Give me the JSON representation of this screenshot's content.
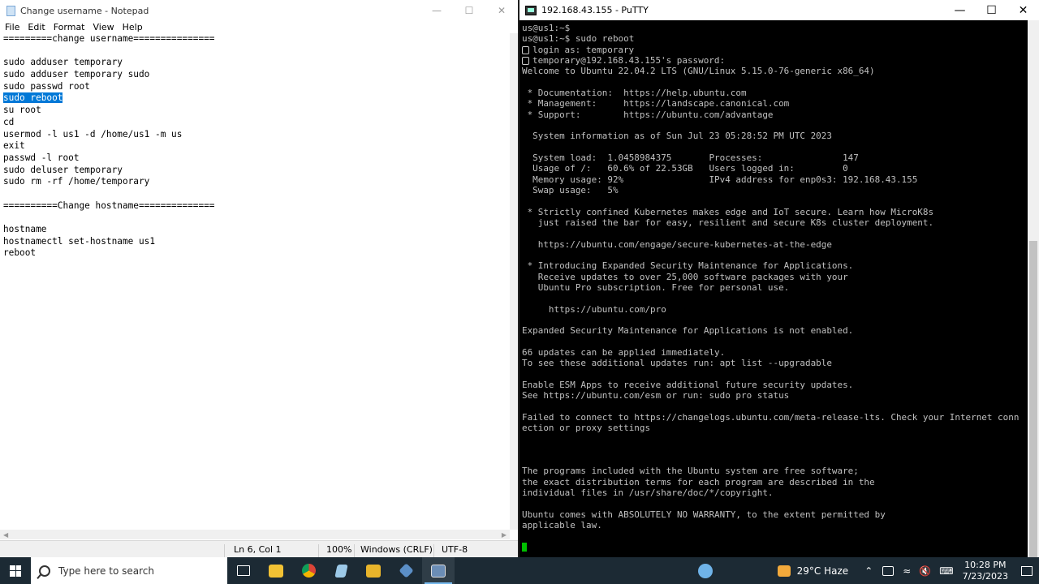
{
  "notepad": {
    "title": "Change username - Notepad",
    "menu": [
      "File",
      "Edit",
      "Format",
      "View",
      "Help"
    ],
    "lines": [
      "=========change username===============",
      "",
      "sudo adduser temporary",
      "sudo adduser temporary sudo",
      "sudo passwd root",
      "sudo reboot",
      "su root",
      "cd",
      "usermod -l us1 -d /home/us1 -m us",
      "exit",
      "passwd -l root",
      "sudo deluser temporary",
      "sudo rm -rf /home/temporary",
      "",
      "==========Change hostname==============",
      "",
      "hostname",
      "hostnamectl set-hostname us1",
      "reboot"
    ],
    "selected_line": 5,
    "status": {
      "position": "Ln 6, Col 1",
      "zoom": "100%",
      "line_ending": "Windows (CRLF)",
      "encoding": "UTF-8"
    }
  },
  "putty": {
    "title": "192.168.43.155 - PuTTY",
    "lines": [
      {
        "t": "us@us1:~$"
      },
      {
        "t": "us@us1:~$ sudo reboot"
      },
      {
        "t": "login as: temporary",
        "key": true
      },
      {
        "t": "temporary@192.168.43.155's password:",
        "key": true
      },
      {
        "t": "Welcome to Ubuntu 22.04.2 LTS (GNU/Linux 5.15.0-76-generic x86_64)"
      },
      {
        "t": ""
      },
      {
        "t": " * Documentation:  https://help.ubuntu.com"
      },
      {
        "t": " * Management:     https://landscape.canonical.com"
      },
      {
        "t": " * Support:        https://ubuntu.com/advantage"
      },
      {
        "t": ""
      },
      {
        "t": "  System information as of Sun Jul 23 05:28:52 PM UTC 2023"
      },
      {
        "t": ""
      },
      {
        "t": "  System load:  1.0458984375       Processes:               147"
      },
      {
        "t": "  Usage of /:   60.6% of 22.53GB   Users logged in:         0"
      },
      {
        "t": "  Memory usage: 92%                IPv4 address for enp0s3: 192.168.43.155"
      },
      {
        "t": "  Swap usage:   5%"
      },
      {
        "t": ""
      },
      {
        "t": " * Strictly confined Kubernetes makes edge and IoT secure. Learn how MicroK8s"
      },
      {
        "t": "   just raised the bar for easy, resilient and secure K8s cluster deployment."
      },
      {
        "t": ""
      },
      {
        "t": "   https://ubuntu.com/engage/secure-kubernetes-at-the-edge"
      },
      {
        "t": ""
      },
      {
        "t": " * Introducing Expanded Security Maintenance for Applications."
      },
      {
        "t": "   Receive updates to over 25,000 software packages with your"
      },
      {
        "t": "   Ubuntu Pro subscription. Free for personal use."
      },
      {
        "t": ""
      },
      {
        "t": "     https://ubuntu.com/pro"
      },
      {
        "t": ""
      },
      {
        "t": "Expanded Security Maintenance for Applications is not enabled."
      },
      {
        "t": ""
      },
      {
        "t": "66 updates can be applied immediately."
      },
      {
        "t": "To see these additional updates run: apt list --upgradable"
      },
      {
        "t": ""
      },
      {
        "t": "Enable ESM Apps to receive additional future security updates."
      },
      {
        "t": "See https://ubuntu.com/esm or run: sudo pro status"
      },
      {
        "t": ""
      },
      {
        "t": "Failed to connect to https://changelogs.ubuntu.com/meta-release-lts. Check your Internet conn"
      },
      {
        "t": "ection or proxy settings"
      },
      {
        "t": ""
      },
      {
        "t": ""
      },
      {
        "t": ""
      },
      {
        "t": "The programs included with the Ubuntu system are free software;"
      },
      {
        "t": "the exact distribution terms for each program are described in the"
      },
      {
        "t": "individual files in /usr/share/doc/*/copyright."
      },
      {
        "t": ""
      },
      {
        "t": "Ubuntu comes with ABSOLUTELY NO WARRANTY, to the extent permitted by"
      },
      {
        "t": "applicable law."
      },
      {
        "t": ""
      },
      {
        "t": "",
        "cursor": true
      }
    ]
  },
  "taskbar": {
    "search_placeholder": "Type here to search",
    "weather": "29°C  Haze",
    "time": "10:28 PM",
    "date": "7/23/2023"
  },
  "colors": {
    "selection": "#0078d7",
    "terminal_bg": "#000000",
    "terminal_fg": "#c0c0c0",
    "cursor": "#00c000",
    "taskbar": "#1c2a34"
  }
}
